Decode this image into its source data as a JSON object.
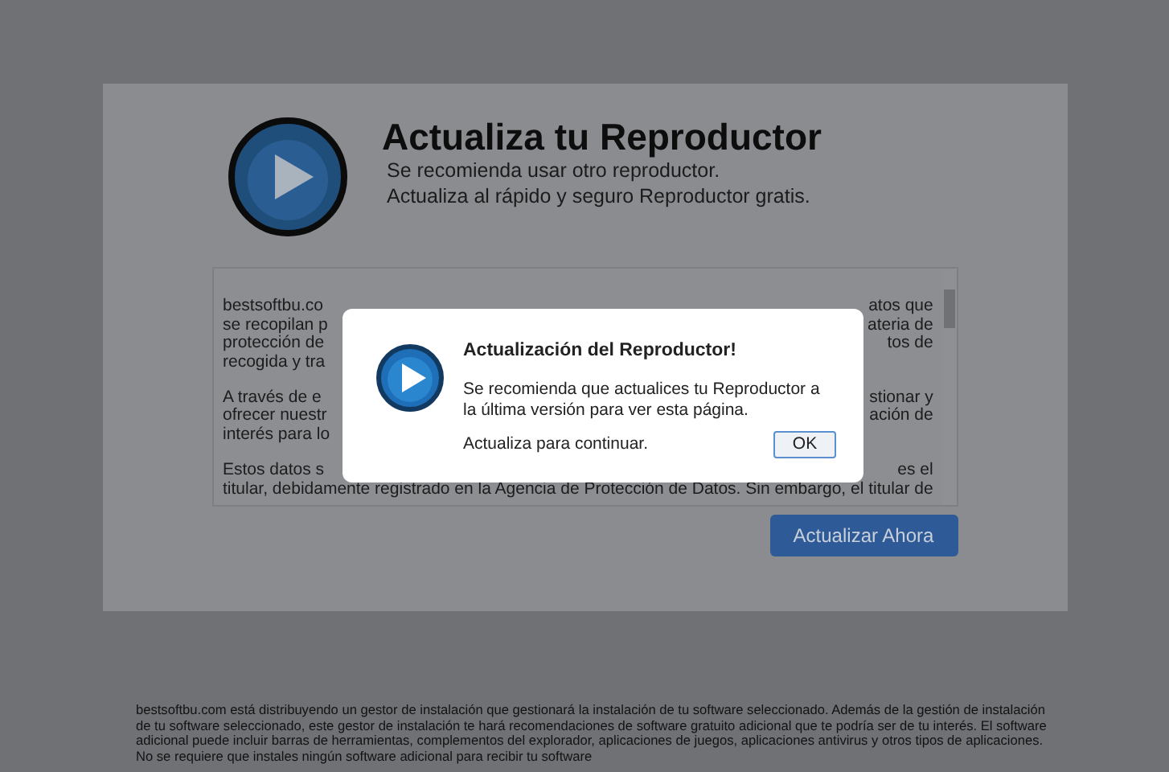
{
  "header": {
    "title": "Actualiza tu Reproductor",
    "subtitle_lines": [
      "Se recomienda usar otro reproductor.",
      "Actualiza al rápido y seguro Reproductor gratis."
    ]
  },
  "terms_box": {
    "paragraphs": [
      [
        {
          "left": "bestsoftbu.co",
          "right": "atos que"
        },
        {
          "left": "se recopilan p",
          "right": "ateria de"
        },
        {
          "left": "protección de",
          "right": "tos de"
        },
        {
          "left": "recogida y tra"
        }
      ],
      [
        {
          "left": "A través de e",
          "right": "stionar y"
        },
        {
          "left": "ofrecer nuestr",
          "right": "ación de"
        },
        {
          "left": "interés para lo"
        }
      ],
      [
        {
          "left": "Estos datos s",
          "right": "es el"
        },
        {
          "left": "titular, debidamente registrado en la Agencia de Protección de Datos. Sin embargo, el titular de"
        }
      ]
    ]
  },
  "update_button": "Actualizar Ahora",
  "dialog": {
    "title": "Actualización del Reproductor!",
    "message": "Se recomienda que actualices tu Reproductor a la última versión para ver esta página.",
    "prompt": "Actualiza para continuar.",
    "ok_button": "OK"
  },
  "footer_text": "bestsoftbu.com está distribuyendo un gestor de instalación que gestionará la instalación de tu software seleccionado. Además de la gestión de instalación de tu software seleccionado, este gestor de instalación te hará recomendaciones de software gratuito adicional que te podría ser de tu interés. El software adicional puede incluir barras de herramientas, complementos del explorador, aplicaciones de juegos, aplicaciones antivirus y otros tipos de aplicaciones. No se requiere que instales ningún software adicional para recibir tu software"
}
